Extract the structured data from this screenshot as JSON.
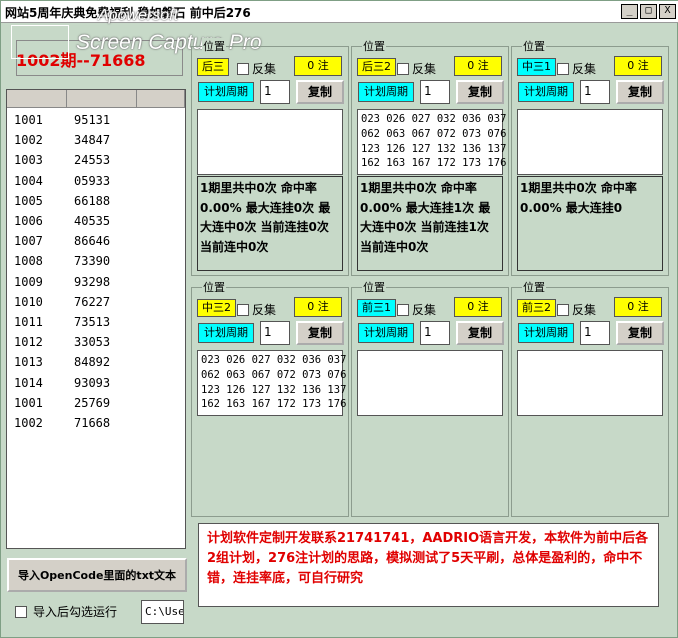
{
  "window": {
    "title": "网站5周年庆典免费福利 稳如磐石 前中后276",
    "buttons": [
      "_",
      "□",
      "X"
    ]
  },
  "watermark": {
    "line1": "Apowersoft",
    "line2": "Screen Capture Pro"
  },
  "current_period": "1002期--71668",
  "history": {
    "rows": [
      {
        "period": "1001",
        "code": "95131"
      },
      {
        "period": "1002",
        "code": "34847"
      },
      {
        "period": "1003",
        "code": "24553"
      },
      {
        "period": "1004",
        "code": "05933"
      },
      {
        "period": "1005",
        "code": "66188"
      },
      {
        "period": "1006",
        "code": "40535"
      },
      {
        "period": "1007",
        "code": "86646"
      },
      {
        "period": "1008",
        "code": "73390"
      },
      {
        "period": "1009",
        "code": "93298"
      },
      {
        "period": "1010",
        "code": "76227"
      },
      {
        "period": "1011",
        "code": "73513"
      },
      {
        "period": "1012",
        "code": "33053"
      },
      {
        "period": "1013",
        "code": "84892"
      },
      {
        "period": "1014",
        "code": "93093"
      },
      {
        "period": "1001",
        "code": "25769"
      },
      {
        "period": "1002",
        "code": "71668"
      }
    ]
  },
  "import_button": "导入OpenCode里面的txt文本",
  "auto_run_label": "导入后勾选运行",
  "path_value": "C:\\Use",
  "panels": [
    {
      "legend": "位置",
      "tag": "后三",
      "tag_color": "yellow",
      "fanji": "反集",
      "zhu": "0 注",
      "plan_label": "计划周期",
      "plan_value": "1",
      "copy": "复制",
      "numbers": "",
      "stats": "1期里共中0次 命中率0.00% 最大连挂0次 最大连中0次 当前连挂0次 当前连中0次"
    },
    {
      "legend": "位置",
      "tag": "后三2",
      "tag_color": "yellow",
      "fanji": "反集",
      "zhu": "0 注",
      "plan_label": "计划周期",
      "plan_value": "1",
      "copy": "复制",
      "numbers": "023 026 027 032 036 037\n062 063 067 072 073 076\n123 126 127 132 136 137\n162 163 167 172 173 176",
      "stats": "1期里共中0次 命中率0.00% 最大连挂1次 最大连中0次 当前连挂1次 当前连中0次"
    },
    {
      "legend": "位置",
      "tag": "中三1",
      "tag_color": "cyan",
      "fanji": "反集",
      "zhu": "0 注",
      "plan_label": "计划周期",
      "plan_value": "1",
      "copy": "复制",
      "numbers": "",
      "stats": "1期里共中0次 命中率0.00% 最大连挂0"
    },
    {
      "legend": "位置",
      "tag": "中三2",
      "tag_color": "yellow",
      "fanji": "反集",
      "zhu": "0 注",
      "plan_label": "计划周期",
      "plan_value": "1",
      "copy": "复制",
      "numbers": "023 026 027 032 036 037\n062 063 067 072 073 076\n123 126 127 132 136 137\n162 163 167 172 173 176",
      "stats": ""
    },
    {
      "legend": "位置",
      "tag": "前三1",
      "tag_color": "cyan",
      "fanji": "反集",
      "zhu": "0 注",
      "plan_label": "计划周期",
      "plan_value": "1",
      "copy": "复制",
      "numbers": "",
      "stats": ""
    },
    {
      "legend": "位置",
      "tag": "前三2",
      "tag_color": "yellow",
      "fanji": "反集",
      "zhu": "0 注",
      "plan_label": "计划周期",
      "plan_value": "1",
      "copy": "复制",
      "numbers": "",
      "stats": ""
    }
  ],
  "info_text": "计划软件定制开发联系21741741，AADRIO语言开发，本软件为前中后各2组计划，276注计划的思路，模拟测试了5天平刷，总体是盈利的，命中不错，连挂率底，可自行研究"
}
